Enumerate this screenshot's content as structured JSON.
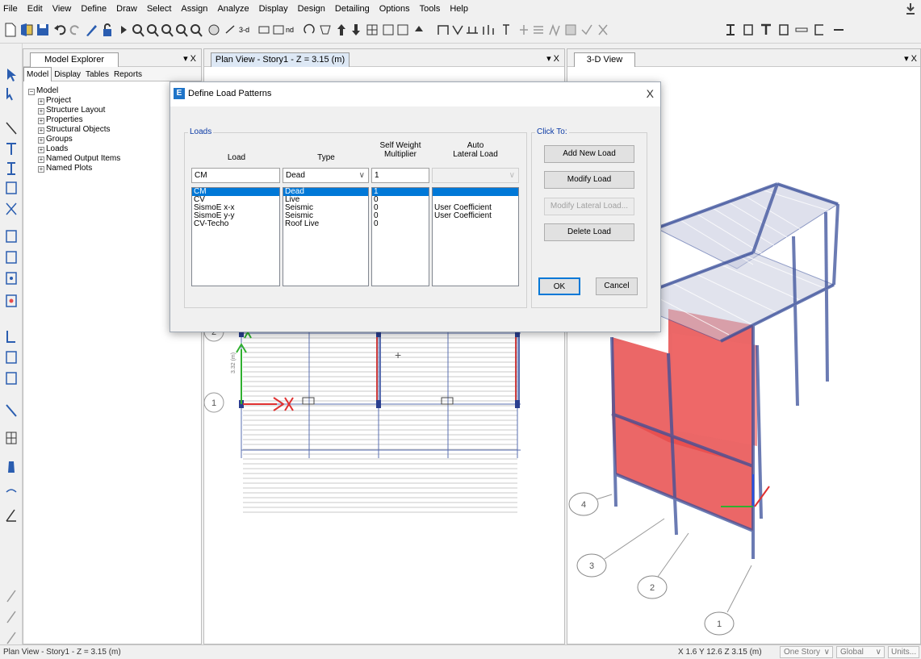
{
  "menu": [
    "File",
    "Edit",
    "View",
    "Define",
    "Draw",
    "Select",
    "Assign",
    "Analyze",
    "Display",
    "Design",
    "Detailing",
    "Options",
    "Tools",
    "Help"
  ],
  "toolbar": {
    "text_3d": "3-d",
    "text_nd": "nd"
  },
  "explorer": {
    "title": "Model Explorer",
    "pin": "▾ X",
    "subtabs": [
      "Model",
      "Display",
      "Tables",
      "Reports"
    ],
    "tree_root": "Model",
    "tree_items": [
      "Project",
      "Structure Layout",
      "Properties",
      "Structural Objects",
      "Groups",
      "Loads",
      "Named Output Items",
      "Named Plots"
    ]
  },
  "plan": {
    "tab": "Plan View - Story1 - Z = 3.15 (m)",
    "pin": "▾ X",
    "grid_labels": [
      "2",
      "1"
    ],
    "dim_text": "3.32 (m)"
  },
  "view3d": {
    "tab": "3-D View",
    "pin": "▾ X",
    "grid_labels": [
      "4",
      "3",
      "2",
      "1"
    ]
  },
  "dialog": {
    "title": "Define Load Patterns",
    "close": "X",
    "loads_group": "Loads",
    "col_load": "Load",
    "col_type": "Type",
    "col_sw": "Self Weight\nMultiplier",
    "col_auto": "Auto\nLateral Load",
    "edit_load": "CM",
    "edit_type": "Dead",
    "edit_sw": "1",
    "edit_auto": "",
    "rows": [
      {
        "load": "CM",
        "type": "Dead",
        "sw": "1",
        "auto": ""
      },
      {
        "load": "CV",
        "type": "Live",
        "sw": "0",
        "auto": ""
      },
      {
        "load": "SismoE x-x",
        "type": "Seismic",
        "sw": "0",
        "auto": "User Coefficient"
      },
      {
        "load": "SismoE y-y",
        "type": "Seismic",
        "sw": "0",
        "auto": "User Coefficient"
      },
      {
        "load": "CV-Techo",
        "type": "Roof Live",
        "sw": "0",
        "auto": ""
      }
    ],
    "click_to": "Click To:",
    "buttons": {
      "add": "Add New Load",
      "modify": "Modify Load",
      "modify_lateral": "Modify Lateral Load...",
      "delete": "Delete Load",
      "ok": "OK",
      "cancel": "Cancel"
    }
  },
  "status": {
    "left": "Plan View - Story1 - Z = 3.15 (m)",
    "coords": "X 1.6  Y 12.6  Z 3.15 (m)",
    "story": "One Story",
    "system": "Global",
    "units": "Units..."
  },
  "colors": {
    "selection": "#0078d7",
    "accent": "#0b3aa5",
    "wall_red": "#e84c4c",
    "frame_blue": "#6a7fc0"
  }
}
